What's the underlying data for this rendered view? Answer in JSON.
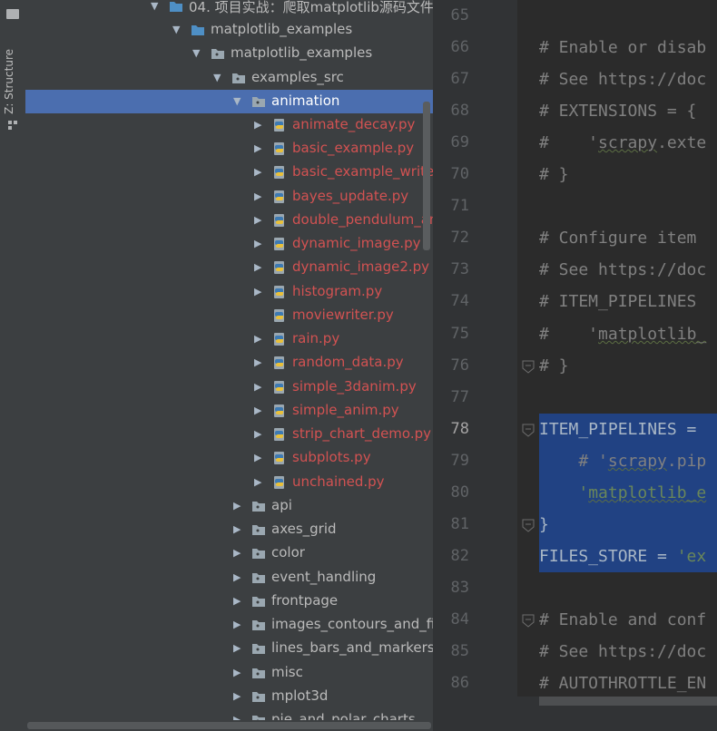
{
  "sidebar": {
    "tool_window_label": "Z: Structure"
  },
  "project_tree": {
    "rows": [
      {
        "label": "04. 项目实战：爬取matplotlib源码文件",
        "kind": "folder-blue",
        "expanded": true,
        "file": false
      },
      {
        "label": "matplotlib_examples",
        "kind": "folder-blue",
        "expanded": true,
        "file": false
      },
      {
        "label": "matplotlib_examples",
        "kind": "package",
        "expanded": true,
        "file": false
      },
      {
        "label": "examples_src",
        "kind": "package",
        "expanded": true,
        "file": false
      },
      {
        "label": "animation",
        "kind": "package",
        "expanded": true,
        "selected": true,
        "file": false
      },
      {
        "label": "animate_decay.py",
        "kind": "python",
        "file": true
      },
      {
        "label": "basic_example.py",
        "kind": "python",
        "file": true
      },
      {
        "label": "basic_example_writer.py",
        "kind": "python",
        "file": true
      },
      {
        "label": "bayes_update.py",
        "kind": "python",
        "file": true
      },
      {
        "label": "double_pendulum_animated.py",
        "kind": "python",
        "file": true
      },
      {
        "label": "dynamic_image.py",
        "kind": "python",
        "file": true
      },
      {
        "label": "dynamic_image2.py",
        "kind": "python",
        "file": true
      },
      {
        "label": "histogram.py",
        "kind": "python",
        "file": true
      },
      {
        "label": "moviewriter.py",
        "kind": "python",
        "file": true,
        "no_arrow": true
      },
      {
        "label": "rain.py",
        "kind": "python",
        "file": true
      },
      {
        "label": "random_data.py",
        "kind": "python",
        "file": true
      },
      {
        "label": "simple_3danim.py",
        "kind": "python",
        "file": true
      },
      {
        "label": "simple_anim.py",
        "kind": "python",
        "file": true
      },
      {
        "label": "strip_chart_demo.py",
        "kind": "python",
        "file": true
      },
      {
        "label": "subplots.py",
        "kind": "python",
        "file": true
      },
      {
        "label": "unchained.py",
        "kind": "python",
        "file": true
      },
      {
        "label": "api",
        "kind": "package",
        "expanded": false,
        "file": false
      },
      {
        "label": "axes_grid",
        "kind": "package",
        "expanded": false,
        "file": false
      },
      {
        "label": "color",
        "kind": "package",
        "expanded": false,
        "file": false
      },
      {
        "label": "event_handling",
        "kind": "package",
        "expanded": false,
        "file": false
      },
      {
        "label": "frontpage",
        "kind": "package",
        "expanded": false,
        "file": false
      },
      {
        "label": "images_contours_and_fields",
        "kind": "package",
        "expanded": false,
        "file": false
      },
      {
        "label": "lines_bars_and_markers",
        "kind": "package",
        "expanded": false,
        "file": false
      },
      {
        "label": "misc",
        "kind": "package",
        "expanded": false,
        "file": false
      },
      {
        "label": "mplot3d",
        "kind": "package",
        "expanded": false,
        "file": false
      },
      {
        "label": "pie_and_polar_charts",
        "kind": "package",
        "expanded": false,
        "file": false
      }
    ]
  },
  "editor": {
    "lines": [
      {
        "num": "65",
        "text": "",
        "kind": "plain"
      },
      {
        "num": "66",
        "text": "# Enable or disab",
        "kind": "comment"
      },
      {
        "num": "67",
        "text": "# See https://doc",
        "kind": "comment"
      },
      {
        "num": "68",
        "text": "# EXTENSIONS = {",
        "kind": "comment"
      },
      {
        "num": "69",
        "text_pre": "#    '",
        "text_wavy": "scrapy",
        "text_post": ".exte",
        "kind": "comment-mixed"
      },
      {
        "num": "70",
        "text": "# }",
        "kind": "comment"
      },
      {
        "num": "71",
        "text": "",
        "kind": "plain"
      },
      {
        "num": "72",
        "text": "# Configure item ",
        "kind": "comment"
      },
      {
        "num": "73",
        "text": "# See https://doc",
        "kind": "comment"
      },
      {
        "num": "74",
        "text": "# ITEM_PIPELINES ",
        "kind": "comment"
      },
      {
        "num": "75",
        "text_pre": "#    '",
        "text_wavy": "matplotlib_",
        "text_post": "",
        "kind": "comment-mixed"
      },
      {
        "num": "76",
        "text": "# }",
        "kind": "comment",
        "fold": true
      },
      {
        "num": "77",
        "text": "",
        "kind": "plain"
      },
      {
        "num": "78",
        "text": "ITEM_PIPELINES = ",
        "kind": "code",
        "selected": true,
        "fold": true,
        "current": true
      },
      {
        "num": "79",
        "text_pre": "    # '",
        "text_wavy": "scrapy",
        "text_post": ".pip",
        "kind": "comment-mixed",
        "selected": true
      },
      {
        "num": "80",
        "text_pre": "    '",
        "text_wavy": "matplotlib_e",
        "text_post": "",
        "kind": "string-mixed",
        "selected": true
      },
      {
        "num": "81",
        "text": "}",
        "kind": "code",
        "selected": true,
        "fold": true
      },
      {
        "num": "82",
        "text_pre": "FILES_STORE = ",
        "text_str": "'ex",
        "kind": "code-str",
        "selected": true
      },
      {
        "num": "83",
        "text": "",
        "kind": "plain"
      },
      {
        "num": "84",
        "text": "# Enable and conf",
        "kind": "comment",
        "fold": true
      },
      {
        "num": "85",
        "text": "# See https://doc",
        "kind": "comment"
      },
      {
        "num": "86",
        "text": "# AUTOTHROTTLE_EN",
        "kind": "comment"
      }
    ]
  },
  "colors": {
    "selection_tree": "#4b6eaf",
    "selection_editor": "#214283",
    "python_file_text": "#d25252",
    "comment": "#808080",
    "string": "#6a8759"
  }
}
